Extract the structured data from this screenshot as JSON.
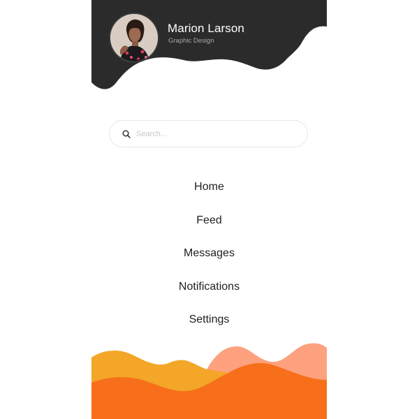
{
  "colors": {
    "header_dark": "#2b2b2b",
    "wave_yellow": "#f3a628",
    "wave_peach": "#fda17f",
    "wave_orange": "#f76f1a"
  },
  "profile": {
    "name": "Marion Larson",
    "role": "Graphic Design"
  },
  "search": {
    "placeholder": "Search...",
    "value": "",
    "icon": "search-icon"
  },
  "nav": {
    "items": [
      {
        "label": "Home"
      },
      {
        "label": "Feed"
      },
      {
        "label": "Messages"
      },
      {
        "label": "Notifications"
      },
      {
        "label": "Settings"
      }
    ]
  }
}
